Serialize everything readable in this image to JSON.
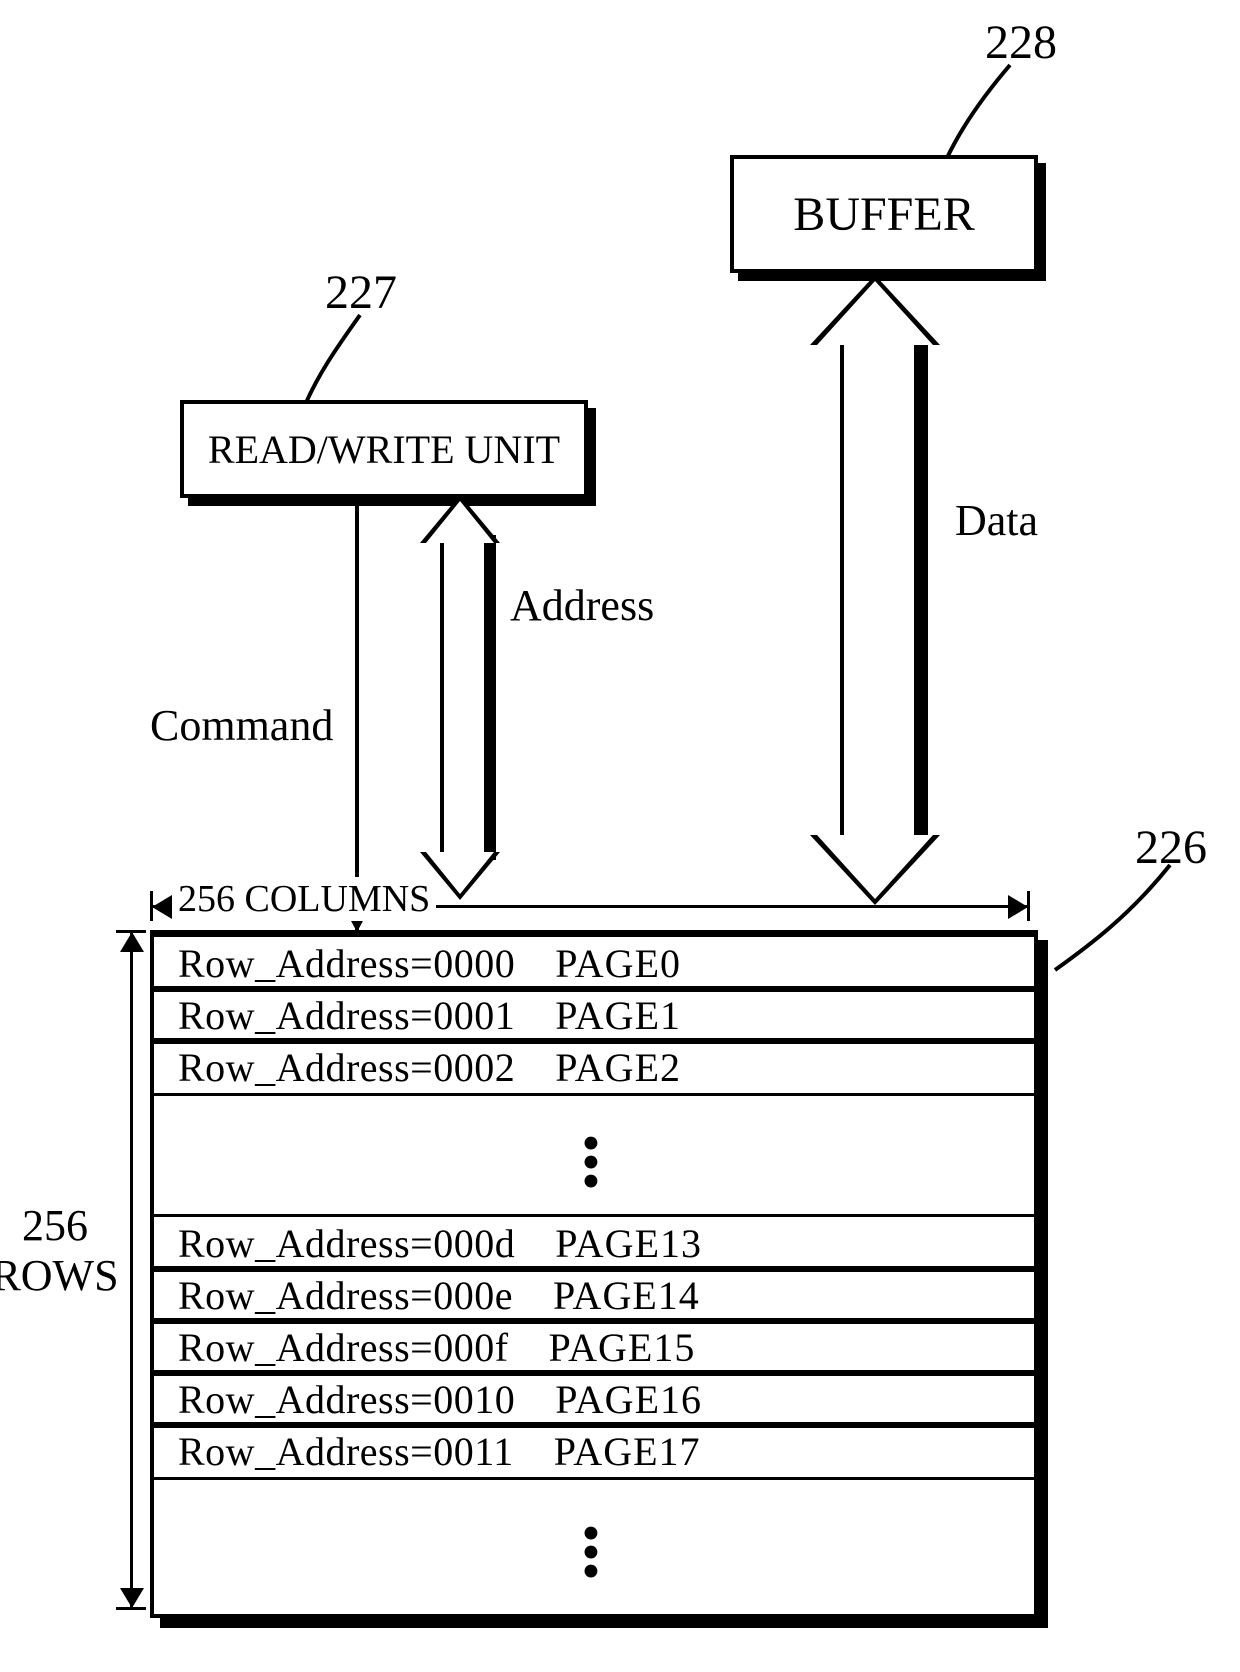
{
  "refs": {
    "buffer": "228",
    "rwunit": "227",
    "memory": "226"
  },
  "blocks": {
    "buffer": "BUFFER",
    "rwunit": "READ/WRITE UNIT"
  },
  "arrows": {
    "data": "Data",
    "command": "Command",
    "address": "Address"
  },
  "dims": {
    "columns": "256 COLUMNS",
    "rows_l1": "256",
    "rows_l2": "ROWS"
  },
  "memory_rows": [
    {
      "addr": "Row_Address=0000",
      "page": "PAGE0"
    },
    {
      "addr": "Row_Address=0001",
      "page": "PAGE1"
    },
    {
      "addr": "Row_Address=0002",
      "page": "PAGE2"
    },
    {
      "addr": "Row_Address=000d",
      "page": "PAGE13"
    },
    {
      "addr": "Row_Address=000e",
      "page": "PAGE14"
    },
    {
      "addr": "Row_Address=000f",
      "page": "PAGE15"
    },
    {
      "addr": "Row_Address=0010",
      "page": "PAGE16"
    },
    {
      "addr": "Row_Address=0011",
      "page": "PAGE17"
    }
  ]
}
